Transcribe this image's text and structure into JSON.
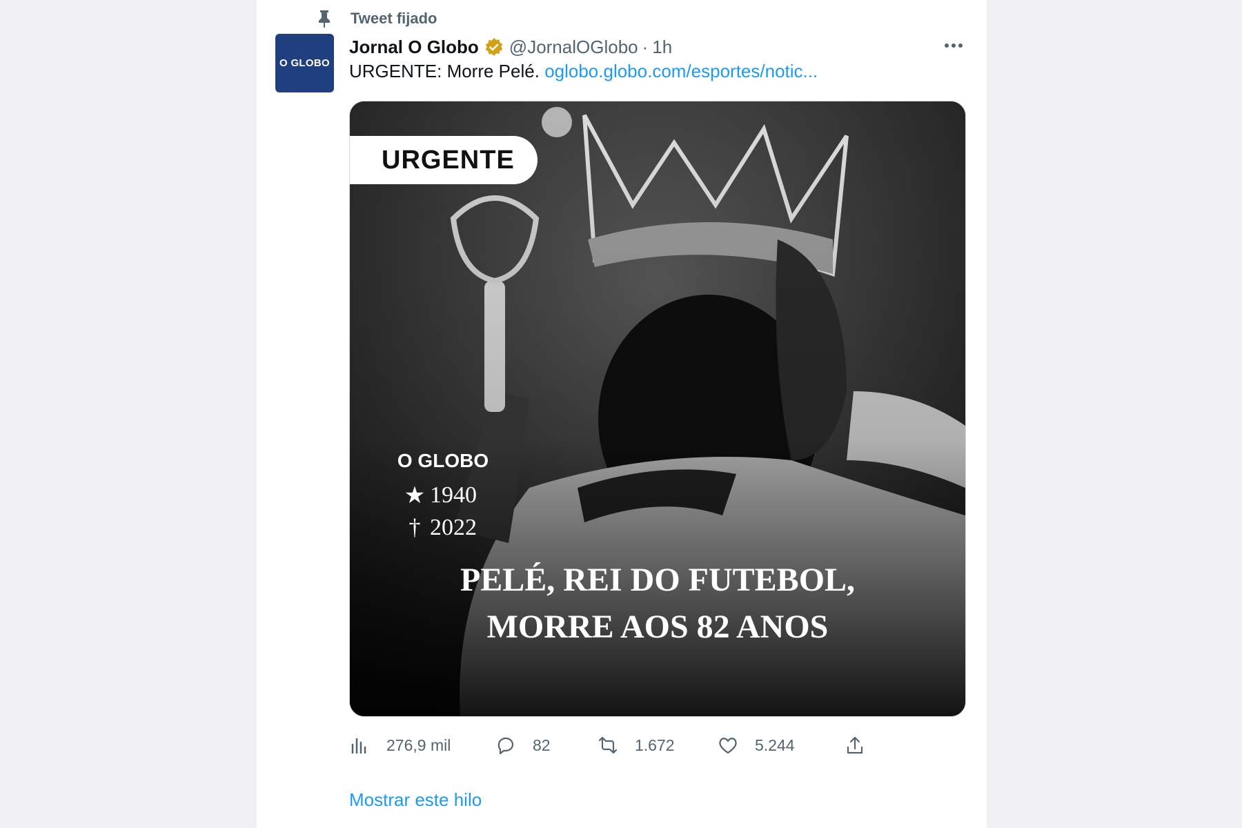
{
  "pinned": {
    "label": "Tweet fijado",
    "icon": "pin-icon"
  },
  "account": {
    "avatar_text": "O GLOBO",
    "name": "Jornal O Globo",
    "verified_color": "#d4a017",
    "handle": "@JornalOGlobo",
    "separator": "·",
    "time": "1h"
  },
  "tweet": {
    "text": "URGENTE: Morre Pelé.",
    "link": "oglobo.globo.com/esportes/notic..."
  },
  "media": {
    "badge": "URGENTE",
    "brand": "O GLOBO",
    "birth_symbol": "★",
    "birth_year": "1940",
    "death_symbol": "†",
    "death_year": "2022",
    "headline_line1": "PELÉ, REI DO FUTEBOL,",
    "headline_line2": "MORRE AOS 82 ANOS"
  },
  "actions": {
    "views": "276,9 mil",
    "replies": "82",
    "retweets": "1.672",
    "likes": "5.244"
  },
  "show_thread": "Mostrar este hilo",
  "colors": {
    "link": "#1d9bf0",
    "muted": "#536471",
    "avatar_bg": "#1f3f7e"
  }
}
